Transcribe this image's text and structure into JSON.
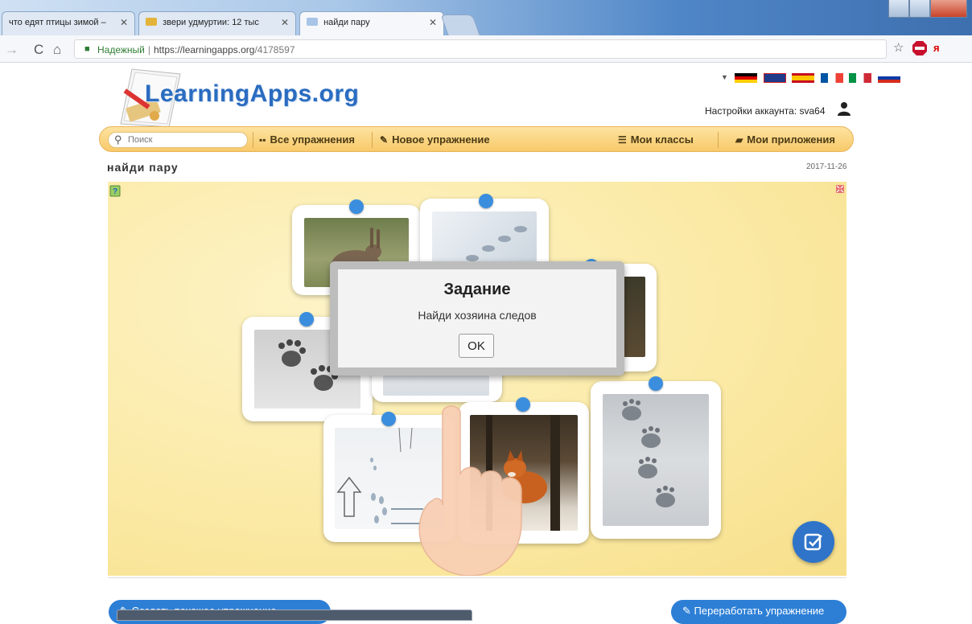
{
  "browser": {
    "tabs": [
      {
        "label": "что едят птицы зимой – "
      },
      {
        "label": "звери удмуртии: 12 тыс"
      },
      {
        "label": "найди пару"
      }
    ],
    "address": {
      "secure_label": "Надежный",
      "protocol": "https://",
      "domain": "learningapps.org",
      "path": "/4178597"
    }
  },
  "site": {
    "logo": "LearningApps.org",
    "account_label": "Настройки аккаунта: sva64",
    "search_placeholder": "Поиск",
    "menu": {
      "all_exercises": "Все упражнения",
      "new_exercise": "Новое упражнение",
      "my_classes": "Мои классы",
      "my_apps": "Мои приложения"
    },
    "page_title": "найди пару",
    "date": "2017-11-26"
  },
  "dialog": {
    "title": "Задание",
    "text": "Найди хозяина следов",
    "ok_label": "OK"
  },
  "footer": {
    "left_button": "Создать похожее упражнение",
    "right_button": "Переработать упражнение"
  },
  "colors": {
    "accent_blue": "#2d7fd6",
    "menu_yellow": "#f8c96a",
    "app_bg": "#fbeaa6",
    "pin_blue": "#3b8ede"
  }
}
